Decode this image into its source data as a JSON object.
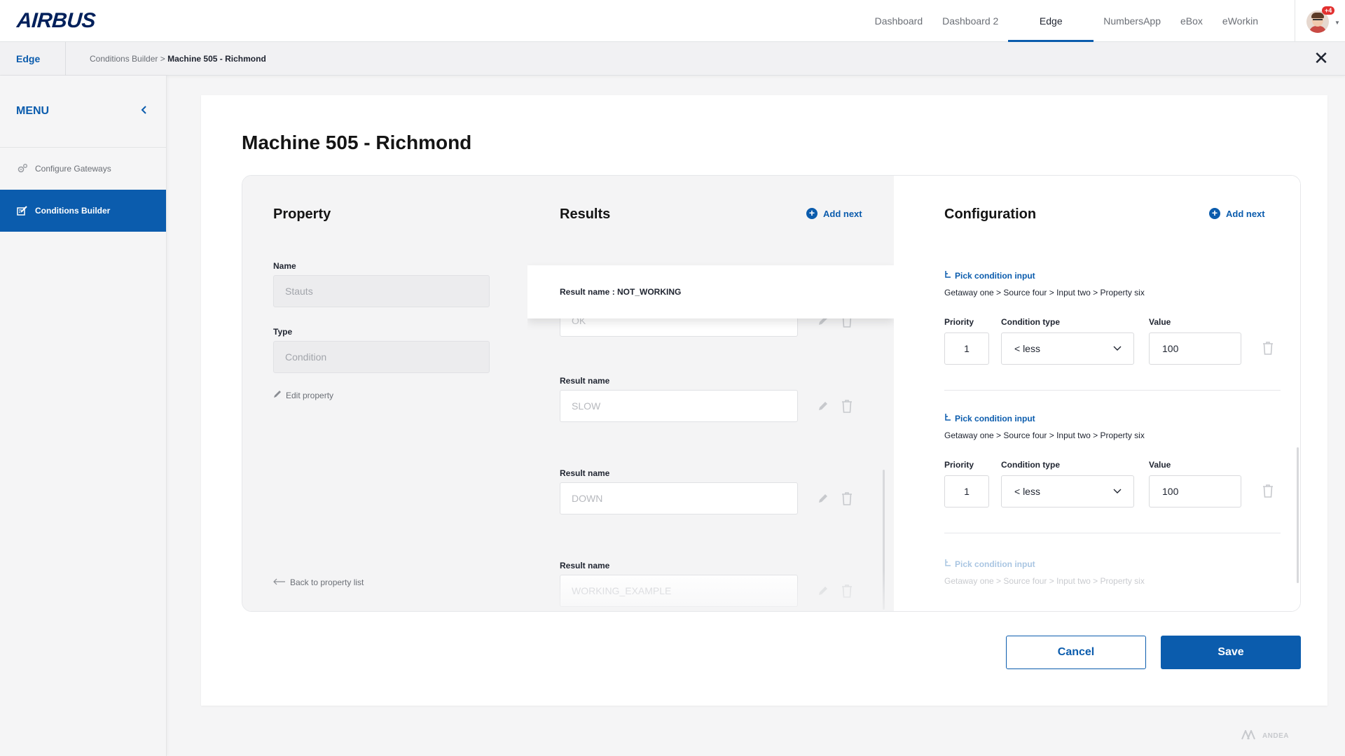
{
  "app": {
    "logo": "AIRBUS",
    "brand_color": "#0b5cad"
  },
  "nav": {
    "tabs": [
      {
        "label": "Dashboard"
      },
      {
        "label": "Dashboard 2"
      },
      {
        "label": "Edge",
        "active": true
      },
      {
        "label": "NumbersApp"
      },
      {
        "label": "eBox"
      },
      {
        "label": "eWorkin"
      }
    ],
    "notification_badge": "+4"
  },
  "breadcrumb": {
    "app": "Edge",
    "parent": "Conditions Builder",
    "separator": " > ",
    "current": "Machine 505 - Richmond"
  },
  "sidebar": {
    "title": "MENU",
    "items": [
      {
        "label": "Configure Gateways",
        "icon": "gears-icon"
      },
      {
        "label": "Conditions Builder",
        "icon": "edit-list-icon",
        "active": true
      }
    ]
  },
  "page": {
    "title": "Machine 505 - Richmond"
  },
  "property": {
    "title": "Property",
    "name_label": "Name",
    "name_value": "Stauts",
    "type_label": "Type",
    "type_value": "Condition",
    "edit_link": "Edit property",
    "back_link": "Back to property list"
  },
  "results": {
    "title": "Results",
    "add_next": "Add next",
    "popup": "Result  name : NOT_WORKING",
    "items": [
      {
        "label": "Result  name",
        "value": "OK"
      },
      {
        "label": "Result  name",
        "value": "SLOW"
      },
      {
        "label": "Result  name",
        "value": "DOWN"
      },
      {
        "label": "Result  name",
        "value": "WORKING_EXAMPLE"
      }
    ]
  },
  "configuration": {
    "title": "Configuration",
    "add_next": "Add next",
    "priority_label": "Priority",
    "condition_type_label": "Condition type",
    "value_label": "Value",
    "conditions": [
      {
        "pick": "Pick condition input",
        "path": "Getaway one > Source four > Input two > Property six",
        "priority": "1",
        "condition_type": "< less",
        "value": "100"
      },
      {
        "pick": "Pick condition input",
        "path": "Getaway one > Source four > Input two > Property six",
        "priority": "1",
        "condition_type": "< less",
        "value": "100"
      },
      {
        "pick": "Pick condition input",
        "path": "Getaway one > Source four > Input two > Property six"
      }
    ]
  },
  "actions": {
    "cancel": "Cancel",
    "save": "Save"
  },
  "footer": {
    "brand": "ANDEA"
  }
}
